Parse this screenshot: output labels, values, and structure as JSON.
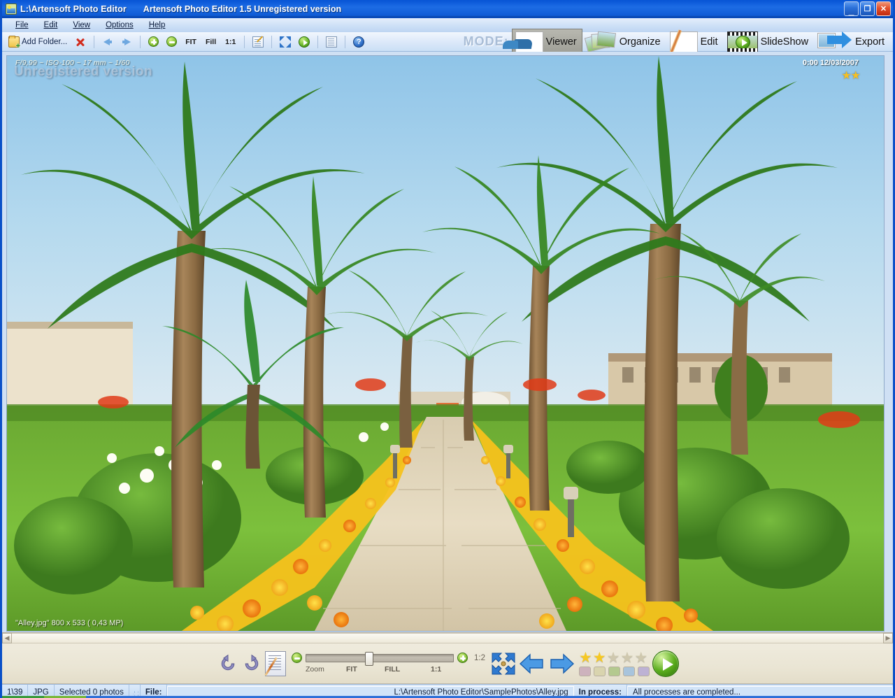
{
  "window": {
    "path_title": "L:\\Artensoft Photo Editor",
    "app_title": "Artensoft Photo Editor 1.5  Unregistered version",
    "app_icon": "photo-editor-icon",
    "buttons": {
      "minimize": "minimize-button",
      "restore": "restore-button",
      "close": "close-button",
      "minimize_glyph": "_",
      "restore_glyph": "❐",
      "close_glyph": "✕"
    }
  },
  "menubar": {
    "items": [
      {
        "label": "File"
      },
      {
        "label": "Edit"
      },
      {
        "label": "View"
      },
      {
        "label": "Options"
      },
      {
        "label": "Help"
      }
    ]
  },
  "toolbar": {
    "add_folder_label": "Add Folder...",
    "add_folder_icon": "folder-add-icon",
    "delete_icon": "delete-red-x-icon",
    "back_icon": "arrow-left-icon",
    "forward_icon": "arrow-right-icon",
    "zoom_in_icon": "zoom-in-plus-icon",
    "zoom_out_icon": "zoom-out-minus-icon",
    "fit_label": "FIT",
    "fill_label": "Fill",
    "one_to_one_label": "1:1",
    "notes_icon": "edit-notes-icon",
    "fullscreen_icon": "fullscreen-icon",
    "slideshow_play_icon": "play-icon",
    "report_icon": "document-icon",
    "help_icon": "help-question-icon"
  },
  "mode": {
    "label": "MODE:",
    "buttons": [
      {
        "label": "Viewer",
        "icon": "viewer-thumb-icon",
        "active": true
      },
      {
        "label": "Organize",
        "icon": "organize-stack-icon",
        "active": false
      },
      {
        "label": "Edit",
        "icon": "edit-pencil-icon",
        "active": false
      },
      {
        "label": "SlideShow",
        "icon": "slideshow-film-icon",
        "active": false
      },
      {
        "label": "Export",
        "icon": "export-arrow-icon",
        "active": false
      }
    ]
  },
  "viewer": {
    "exif_overlay": "F/9,99 ~ ISO-100 ~ 17 mm ~ 1/60",
    "watermark": "Unregistered version",
    "date_overlay": "0:00 12/03/2007",
    "rating_overlay": "★★",
    "caption": "\"Alley.jpg\"  800 x 533 ( 0,43 MP)",
    "image_alt": "palm-tree-garden-alley-photo"
  },
  "filmstrip": {
    "scroll_left_icon": "scroll-left-icon",
    "scroll_right_icon": "scroll-right-icon",
    "left_glyph": "◀",
    "right_glyph": "▶"
  },
  "bottombar": {
    "rotate_ccw_icon": "rotate-counter-clockwise-icon",
    "rotate_cw_icon": "rotate-clockwise-icon",
    "edit_doc_icon": "edit-document-icon",
    "zoom_out_icon": "zoom-out-minus-icon",
    "zoom_in_icon": "zoom-in-plus-icon",
    "zoom_label": "Zoom",
    "fit_label": "FIT",
    "fill_label": "FILL",
    "one_to_one_label": "1:1",
    "zoom_ratio": "1:2",
    "fullscreen_icon": "fullscreen-icon",
    "prev_icon": "previous-photo-arrow-icon",
    "next_icon": "next-photo-arrow-icon",
    "play_icon": "start-slideshow-icon",
    "rating": {
      "value": 2,
      "max": 5,
      "star_on_glyph": "★",
      "star_off_glyph": "★"
    },
    "color_labels": [
      "#cdb2bd",
      "#d9d4ae",
      "#b4c98f",
      "#a8c4dc",
      "#bdb2d4"
    ]
  },
  "statusbar": {
    "index": "1\\39",
    "format": "JPG",
    "selection": "Selected 0 photos",
    "busy_icon": "busy-dots-icon",
    "file_label": "File:",
    "file_value": "L:\\Artensoft Photo Editor\\SamplePhotos\\Alley.jpg",
    "process_label": "In process:",
    "process_value": "All processes are completed..."
  },
  "colors": {
    "title_bar": "#0a58d8",
    "accent_blue": "#2f6fc8",
    "toolbar_bg": "#dfeafa",
    "bottom_bg": "#eae5d4",
    "status_bg": "#cfe2f6",
    "star_gold": "#f6c823",
    "star_grey": "#cfc8ae"
  }
}
